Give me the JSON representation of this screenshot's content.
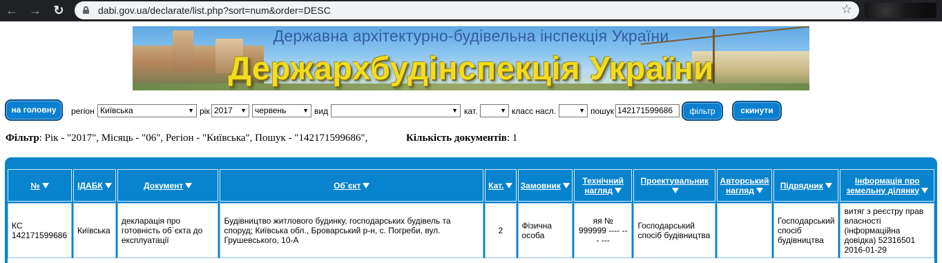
{
  "browser": {
    "url": "dabi.gov.ua/declarate/list.php?sort=num&order=DESC"
  },
  "banner": {
    "subtitle": "Державна архітектурно-будівельна інспекція України",
    "title": "Держархбудінспекція України"
  },
  "filters": {
    "home_button": "на головну",
    "region_label": "регіон",
    "region_value": "Київська",
    "year_label": "рік",
    "year_value": "2017",
    "month_value": "червень",
    "type_label": "вид",
    "type_value": "",
    "category_label": "кат.",
    "category_value": "",
    "class_label": "класс насл.",
    "class_value": "",
    "search_label": "пошук",
    "search_value": "142171599686",
    "filter_button": "фільтр",
    "reset_button": "скинути"
  },
  "summary": {
    "filter_label": "Фільтр",
    "filter_text": ": Рік - \"2017\", Місяць - \"06\", Регіон - \"Київська\", Пошук - \"142171599686\",",
    "count_label": "Кількість документів",
    "count_value": ": 1"
  },
  "table": {
    "headers": [
      "№",
      "ІДАБК",
      "Документ",
      "Об`єкт",
      "Кат.",
      "Замовник",
      "Технічний нагляд",
      "Проектувальник",
      "Авторський нагляд",
      "Підрядник",
      "Інформація про земельну ділянку"
    ],
    "rows": [
      {
        "num": "КС 142171599686",
        "idabk": "Київська",
        "document": "декларація про готовність об`єкта до експлуатації",
        "object": "Будівництво житлового будинку, господарських будівель та споруд; Київська обл., Броварський р-н, с. Погреби, вул. Грушевського, 10-А",
        "category": "2",
        "customer": "Фізична особа",
        "tech_supervision": "яя № 999999 ---- --- ---",
        "designer": "Господарський спосіб будівництва",
        "author_supervision": "",
        "contractor": "Господарський спосіб будівництва",
        "land_info": "витяг з реєстру прав власності (інформаційна довідка) 52316501 2016-01-29"
      }
    ]
  },
  "colors": {
    "accent": "#0883cd",
    "button_border": "#0a4f86",
    "chrome_bg": "#202124"
  }
}
